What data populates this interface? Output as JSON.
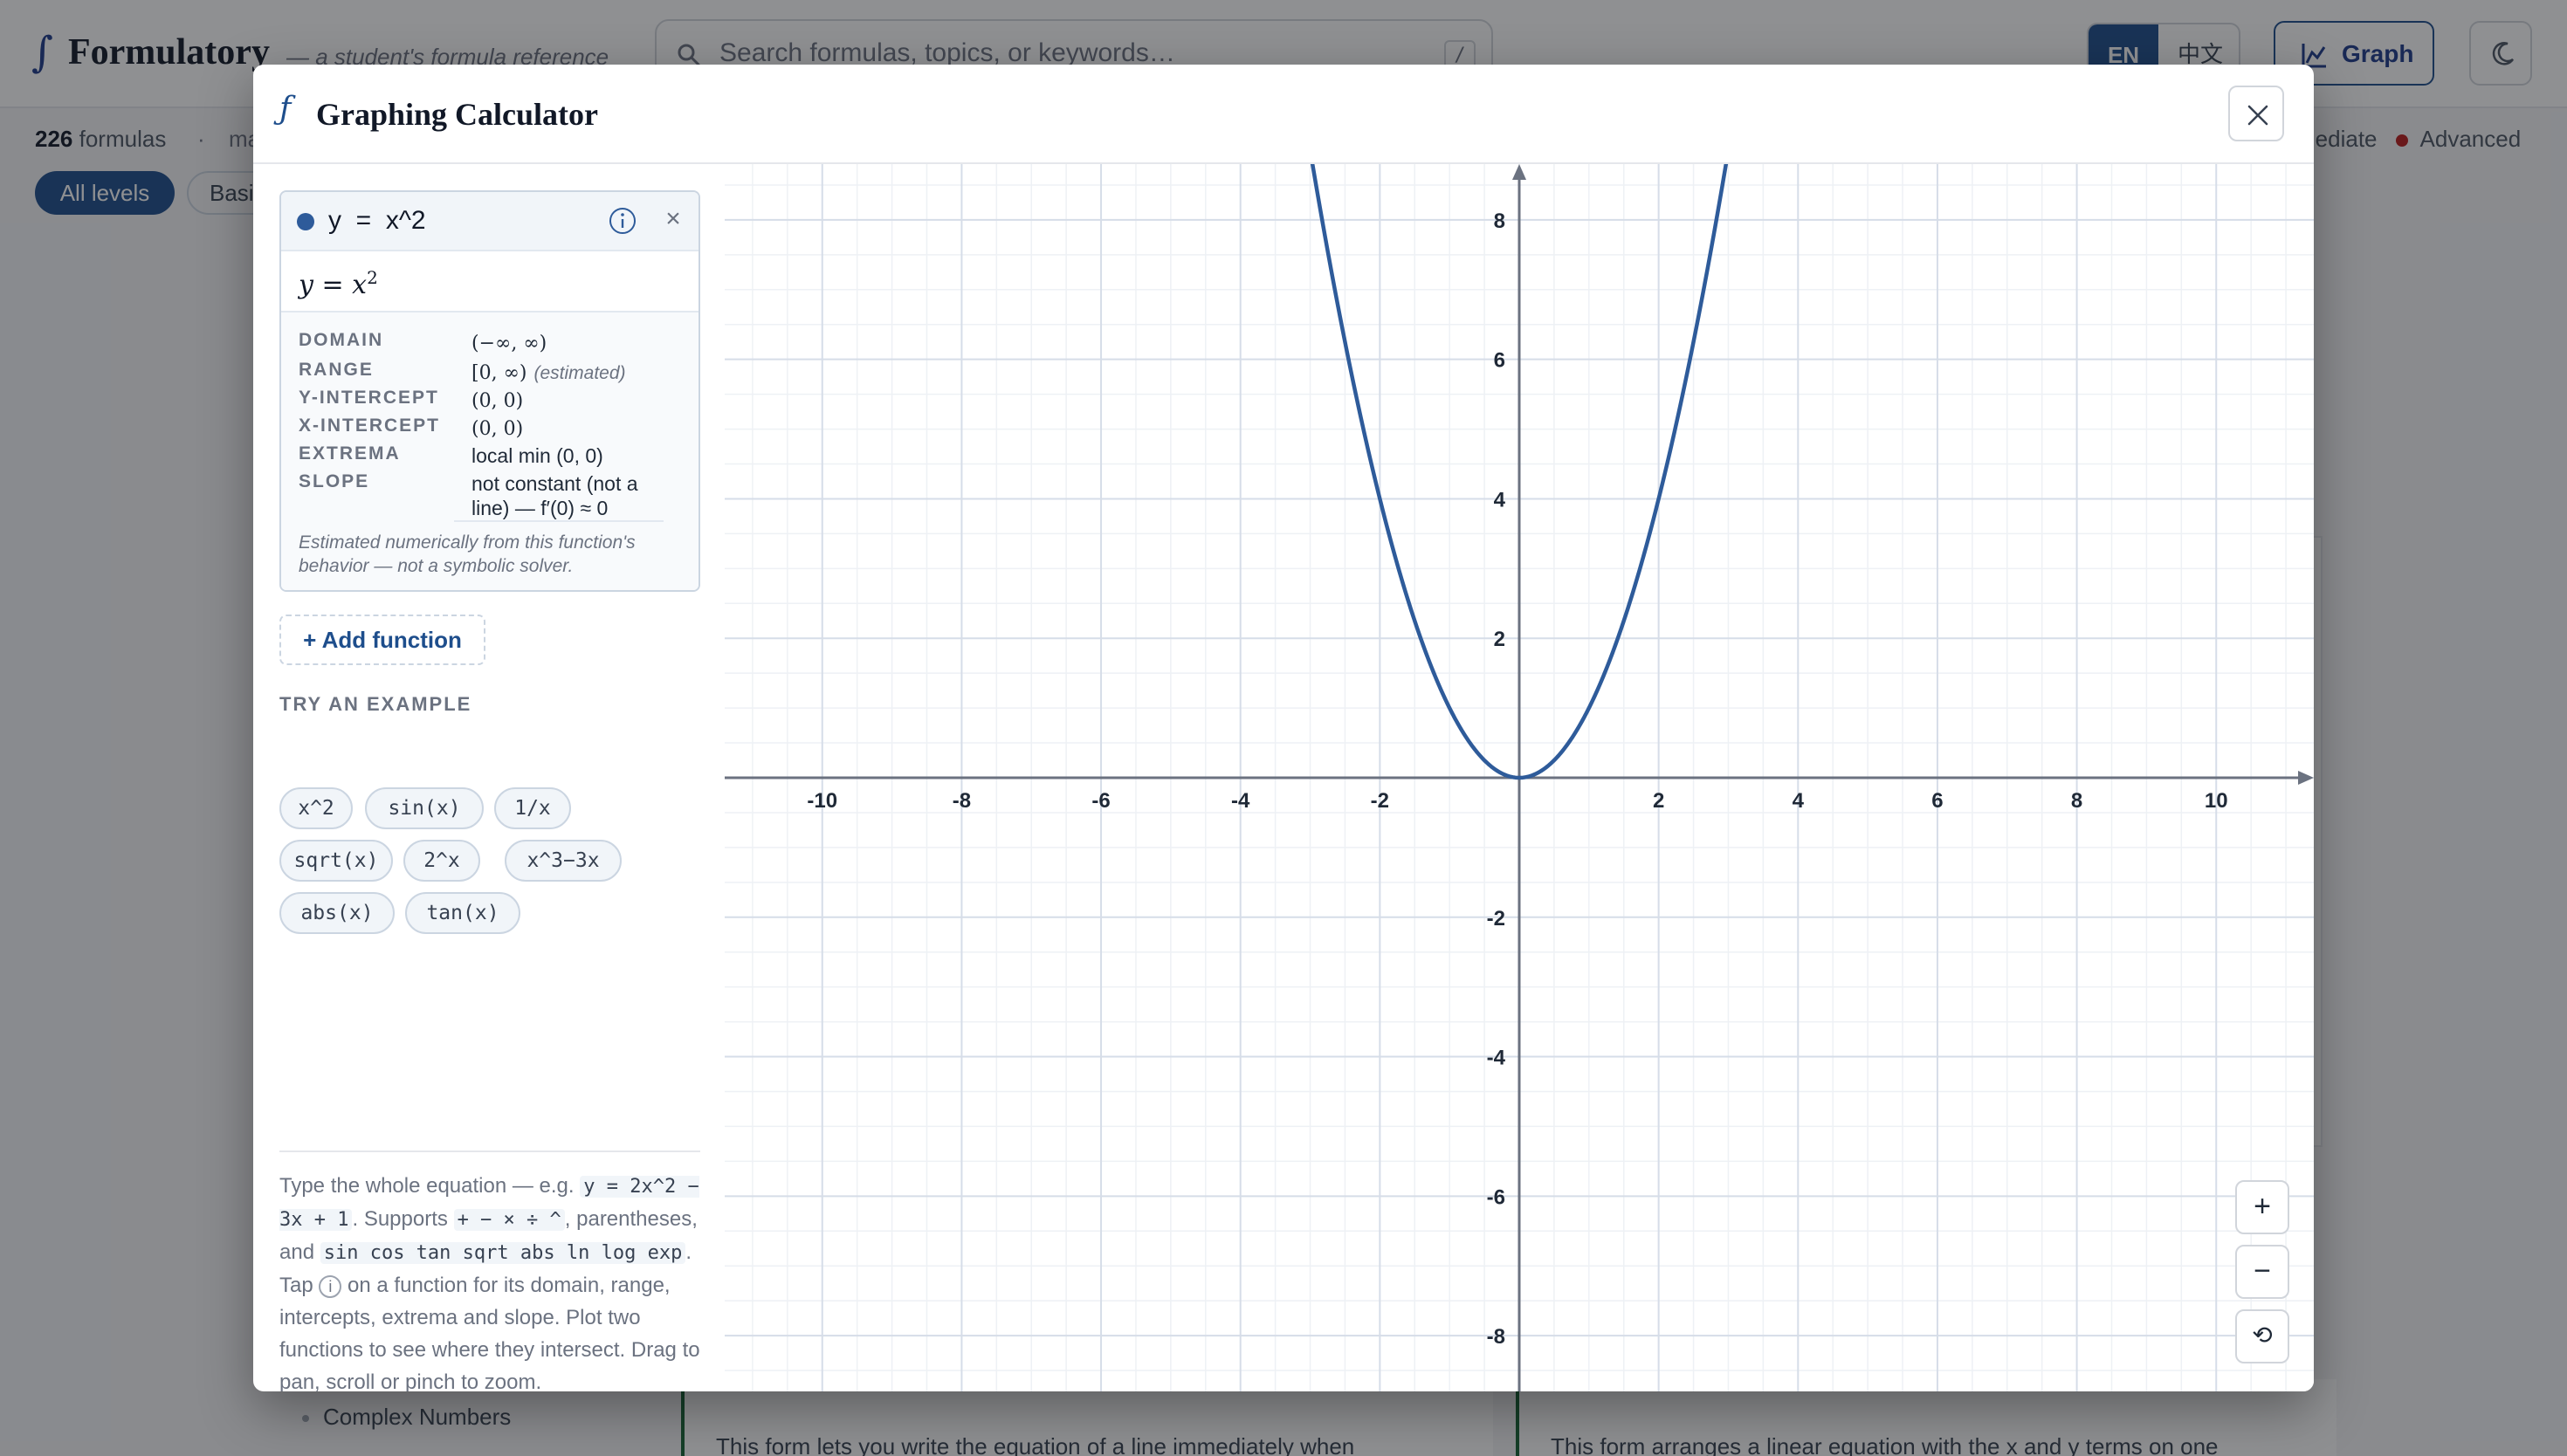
{
  "app": {
    "logo_mark": "∫",
    "name": "Formulatory",
    "tagline": "— a student's formula reference"
  },
  "search": {
    "placeholder": "Search formulas, topics, or keywords…",
    "shortcut": "/"
  },
  "header": {
    "lang_en": "EN",
    "lang_zh": "中文",
    "graph_button": "Graph"
  },
  "subbar": {
    "count_number": "226",
    "count_label": "formulas",
    "separator": "·",
    "more_text": "ma",
    "level_legend_tail": "mediate",
    "level_advanced": "Advanced"
  },
  "level_chips": {
    "all": "All levels",
    "basic": "Basi"
  },
  "background": {
    "card_left_text": "This form lets you write the equation of a line immediately when",
    "card_right_text": "This form arranges a linear equation with the x and y terms on one",
    "sidebar_item": "Complex Numbers"
  },
  "modal": {
    "icon": "ƒ",
    "title": "Graphing Calculator"
  },
  "function": {
    "expression": "y  =  x^2",
    "color": "#2e5b9a",
    "remove_symbol": "×",
    "rendered_lhs": "y = x",
    "rendered_exp": "2",
    "properties": [
      {
        "key": "DOMAIN",
        "value": "(−∞, ∞)",
        "note": ""
      },
      {
        "key": "RANGE",
        "value": "[0, ∞)",
        "note": "(estimated)"
      },
      {
        "key": "Y-INTERCEPT",
        "value": "(0, 0)",
        "note": ""
      },
      {
        "key": "X-INTERCEPT",
        "value": "(0, 0)",
        "note": ""
      },
      {
        "key": "EXTREMA",
        "value": "local min (0, 0)",
        "note": ""
      },
      {
        "key": "SLOPE",
        "value": "not constant (not a line) — f′(0) ≈ 0",
        "note": ""
      }
    ],
    "note": "Estimated numerically from this function's behavior — not a symbolic solver."
  },
  "add_function_label": "+ Add function",
  "try_example_label": "TRY AN EXAMPLE",
  "examples": [
    "x^2",
    "sin(x)",
    "1/x",
    "sqrt(x)",
    "2^x",
    "x^3−3x",
    "abs(x)",
    "tan(x)"
  ],
  "help": {
    "p1": "Type the whole equation — e.g.",
    "code1": "y = 2x^2 − 3x + 1",
    "p2": ". Supports",
    "code2": "+ − × ÷ ^",
    "p3": ", parentheses, and",
    "code3": "sin cos tan sqrt abs ln log exp",
    "p4": ". Tap",
    "info_symbol": "i",
    "p5": "on a function for its domain, range, intercepts, extrema and slope. Plot two functions to see where they intersect. Drag to pan, scroll or pinch to zoom."
  },
  "graph": {
    "x_range": [
      -11.4,
      11.4
    ],
    "y_range": [
      -8.8,
      8.8
    ],
    "x_tick_labels": [
      "-10",
      "-8",
      "-6",
      "-4",
      "-2",
      "2",
      "4",
      "6",
      "8",
      "10"
    ],
    "y_tick_labels": [
      "8",
      "6",
      "4",
      "2",
      "-2",
      "-4",
      "-6",
      "-8"
    ],
    "curve": "y = x^2",
    "curve_color": "#2e5b9a"
  },
  "zoom": {
    "in": "+",
    "out": "−",
    "reset": "⟲"
  }
}
